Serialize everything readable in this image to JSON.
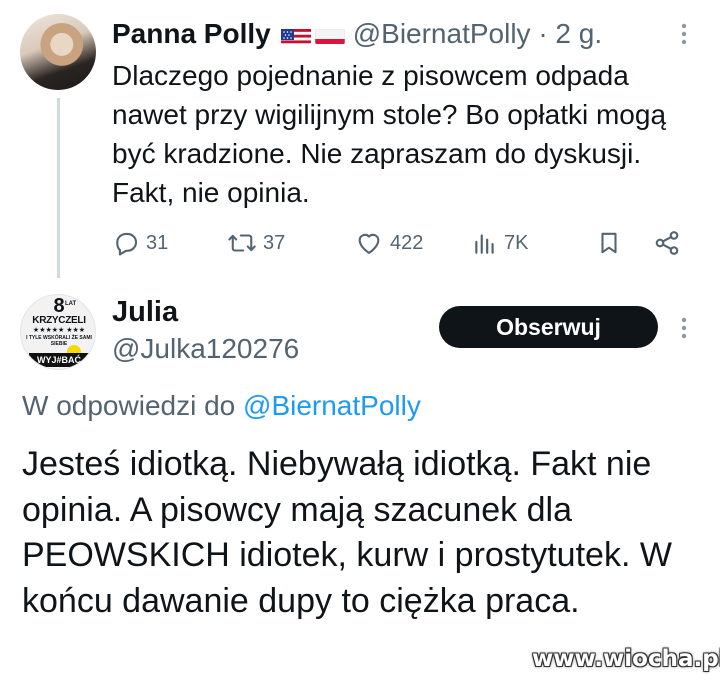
{
  "tweet1": {
    "author_name": "Panna Polly",
    "flags": [
      "us-flag",
      "pl-flag"
    ],
    "handle_time": "@BiernatPolly · 2 g.",
    "text": "Dlaczego pojednanie z pisowcem odpada nawet przy wigilijnym stole? Bo opłatki mogą być kradzione. Nie zapraszam do dyskusji. Fakt, nie opinia.",
    "actions": {
      "replies": "31",
      "reposts": "37",
      "likes": "422",
      "views": "7K"
    },
    "icons": [
      "reply-icon",
      "repost-icon",
      "like-icon",
      "views-icon",
      "bookmark-icon",
      "share-icon",
      "more-icon"
    ]
  },
  "tweet2": {
    "avatar": {
      "eight": "8",
      "lat": "LAT",
      "name": "KRZYCZELI",
      "stars": "★★★★★ ★★★",
      "sub": "I TYLE WSKÓRALI ŻE SAMI SIEBIE",
      "bottom": "WYJ#BAĆ"
    },
    "author_name": "Julia",
    "handle": "@Julka120276",
    "follow_label": "Obserwuj",
    "reply_prefix": "W odpowiedzi do",
    "reply_mention": "@BiernatPolly",
    "text": "Jesteś idiotką. Niebywałą idiotką. Fakt nie opinia. A pisowcy mają szacunek dla PEOWSKICH idiotek, kurw i prostytutek. W końcu dawanie dupy to ciężka praca."
  },
  "watermark": "www.wiocha.pl",
  "colors": {
    "text": "#0f1419",
    "secondary": "#536471",
    "link": "#1d9bf0",
    "button_bg": "#0f1419"
  }
}
